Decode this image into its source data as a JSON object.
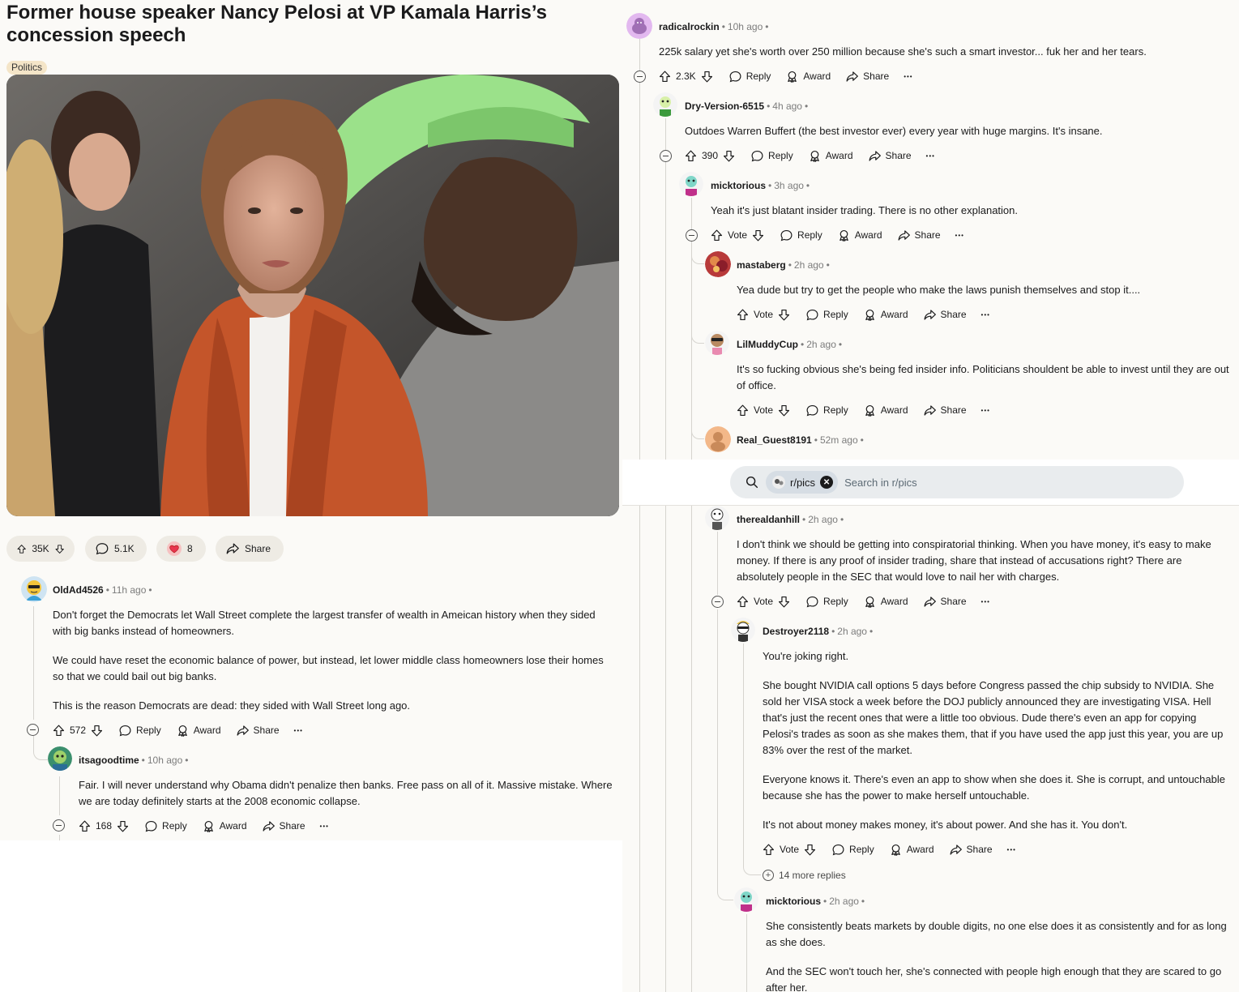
{
  "post": {
    "title": "Former house speaker Nancy Pelosi at VP Kamala Harris’s concession speech",
    "flair": "Politics",
    "image_alt": "photo",
    "upvotes": "35K",
    "comments": "5.1K",
    "awards": "8",
    "share_label": "Share"
  },
  "labels": {
    "reply": "Reply",
    "award": "Award",
    "share": "Share",
    "vote": "Vote",
    "more": "•••"
  },
  "search": {
    "chip": "r/pics",
    "placeholder": "Search in r/pics"
  },
  "left_comments": [
    {
      "user": "OldAd4526",
      "time": "11h ago",
      "paragraphs": [
        "Don't forget the Democrats let Wall Street complete the largest transfer of wealth in Ameican history when they sided with big banks instead of homeowners.",
        "We could have reset the economic balance of power, but instead, let lower middle class homeowners lose their homes so that we could bail out big banks.",
        "This is the reason Democrats are dead: they sided with Wall Street long ago."
      ],
      "score": "572"
    },
    {
      "user": "itsagoodtime",
      "time": "10h ago",
      "paragraphs": [
        "Fair. I will never understand why Obama didn't penalize then banks. Free pass on all of it. Massive mistake. Where we are today definitely starts at the 2008 economic collapse."
      ],
      "score": "168"
    }
  ],
  "right_comments": [
    {
      "user": "radicalrockin",
      "time": "10h ago",
      "paragraphs": [
        "225k salary yet she's worth over 250 million because she's such a smart investor... fuk her and her tears."
      ],
      "score": "2.3K"
    },
    {
      "user": "Dry-Version-6515",
      "time": "4h ago",
      "paragraphs": [
        "Outdoes Warren Buffert (the best investor ever) every year with huge margins. It's insane."
      ],
      "score": "390"
    },
    {
      "user": "micktorious",
      "time": "3h ago",
      "paragraphs": [
        "Yeah it's just blatant insider trading. There is no other explanation."
      ],
      "score": "Vote"
    },
    {
      "user": "mastaberg",
      "time": "2h ago",
      "paragraphs": [
        "Yea dude but try to get the people who make the laws punish themselves and stop it...."
      ],
      "score": "Vote"
    },
    {
      "user": "LilMuddyCup",
      "time": "2h ago",
      "paragraphs": [
        "It's so fucking obvious she's being fed insider info. Politicians shouldent be able to invest until they are out of office."
      ],
      "score": "Vote"
    },
    {
      "user": "Real_Guest8191",
      "time": "52m ago"
    },
    {
      "user": "therealdanhill",
      "time": "2h ago",
      "paragraphs": [
        "I don't think we should be getting into conspiratorial thinking. When you have money, it's easy to make money. If there is any proof of insider trading, share that instead of accusations right? There are absolutely people in the SEC that would love to nail her with charges."
      ],
      "score": "Vote"
    },
    {
      "user": "Destroyer2118",
      "time": "2h ago",
      "paragraphs": [
        "You're joking right.",
        "She bought NVIDIA call options 5 days before Congress passed the chip subsidy to NVIDIA. She sold her VISA stock a week before the DOJ publicly announced they are investigating VISA. Hell that's just the recent ones that were a little too obvious. Dude there's even an app for copying Pelosi's trades as soon as she makes them, that if you have used the app just this year, you are up 83% over the rest of the market.",
        "Everyone knows it. There's even an app to show when she does it. She is corrupt, and untouchable because she has the power to make herself untouchable.",
        "It's not about money makes money, it's about power. And she has it. You don't."
      ],
      "score": "Vote",
      "more_replies": "14 more replies"
    },
    {
      "user": "micktorious",
      "time": "2h ago",
      "paragraphs": [
        "She consistently beats markets by double digits, no one else does it as consistently and for as long as she does.",
        "And the SEC won't touch her, she's connected with people high enough that they are scared to go after her."
      ]
    }
  ]
}
